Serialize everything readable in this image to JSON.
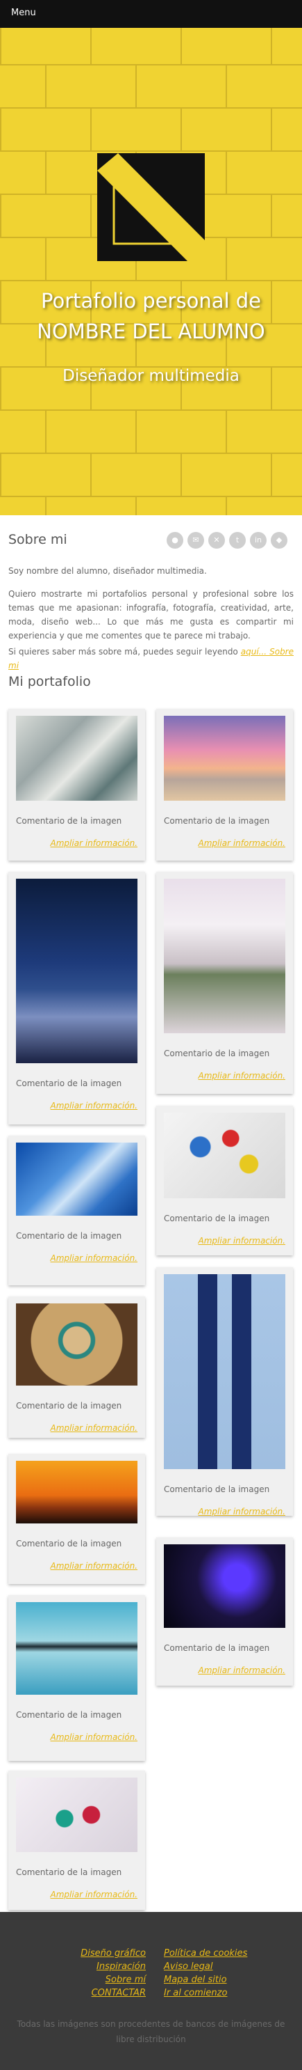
{
  "menu": {
    "label": "Menu"
  },
  "hero": {
    "title_line1": "Portafolio personal de",
    "title_line2": "NOMBRE DEL ALUMNO",
    "subtitle": "Diseñador multimedia"
  },
  "about": {
    "title": "Sobre mi",
    "social_icons": [
      "github-icon",
      "email-icon",
      "xing-icon",
      "twitter-icon",
      "linkedin-icon",
      "generic-icon"
    ],
    "p1": "Soy nombre del alumno, diseñador multimedia.",
    "p2": "Quiero mostrarte mi portafolios personal y profesional sobre los temas que me apasionan: infografía, fotografía, creatividad, arte, moda, diseño web... Lo que más me gusta es compartir mi experiencia y que me comentes que te parece mi trabajo.",
    "p3_prefix": "Si quieres saber más sobre má, puedes seguir leyendo ",
    "p3_link": "aquí... Sobre mi"
  },
  "portfolio": {
    "title": "Mi portafolio",
    "comment": "Comentario de la imagen",
    "more": "Ampliar información.",
    "images": [
      "feathers-photo",
      "beach-sunset-photo",
      "night-sky-city-photo",
      "girl-window-photo",
      "paint-palette-photo",
      "ice-cave-photo",
      "woman-wheel-photo",
      "shoes-pair-photo",
      "orange-sunset-photo",
      "glitter-face-photo",
      "reflection-silhouette-photo",
      "nail-polish-photo"
    ]
  },
  "footer": {
    "links_left": [
      "Diseño gráfico",
      "Inspiración",
      "Sobre mí",
      "CONTACTAR"
    ],
    "links_right": [
      "Política de cookies",
      "Aviso legal",
      "Mapa del sitio",
      "Ir al comienzo"
    ],
    "note": "Todas las imágenes son procedentes de bancos de imágenes de libre distribución"
  }
}
